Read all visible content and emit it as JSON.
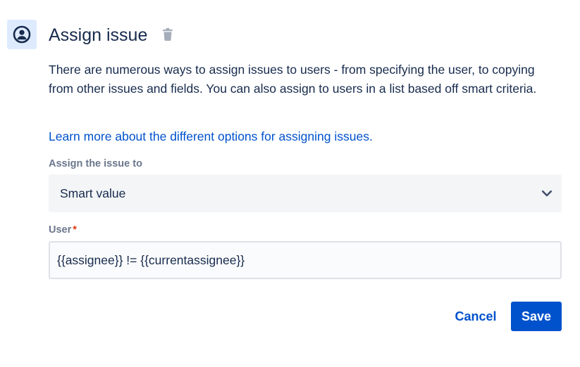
{
  "header": {
    "title": "Assign issue",
    "icon": "user-avatar-icon",
    "action_icon": "trash-icon"
  },
  "description": "There are numerous ways to assign issues to users - from specifying the user, to copying from other issues and fields. You can also assign to users in a list based off smart criteria.",
  "learn_more_link": "Learn more about the different options for assigning issues.",
  "assign_field": {
    "label": "Assign the issue to",
    "selected": "Smart value"
  },
  "user_field": {
    "label": "User",
    "required_marker": "*",
    "value": "{{assignee}} != {{currentassignee}}"
  },
  "actions": {
    "cancel_label": "Cancel",
    "save_label": "Save"
  },
  "colors": {
    "primary": "#0052CC",
    "text": "#172B4D",
    "label": "#6B778C",
    "required": "#DE350B",
    "icon_tile_bg": "#DEEBFF"
  }
}
